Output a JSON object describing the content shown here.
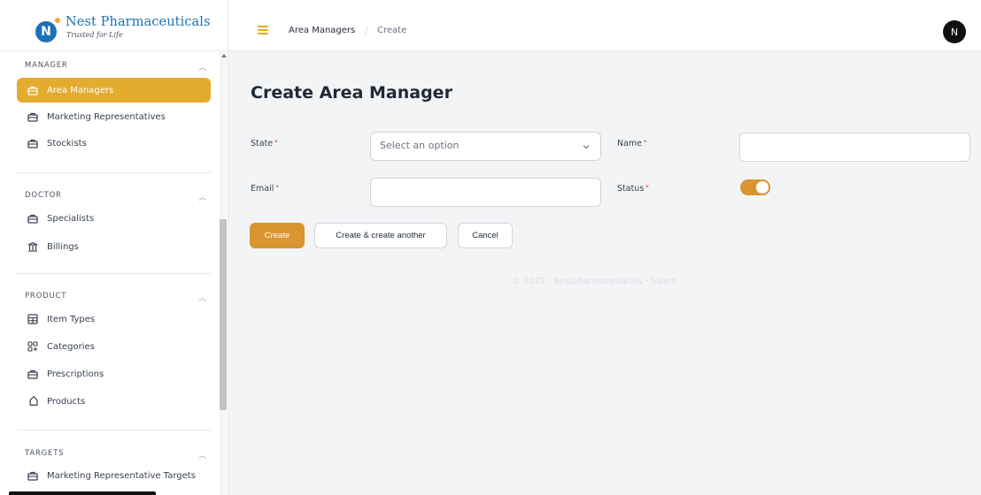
{
  "brand": {
    "name": "Nest Pharmaceuticals",
    "tagline": "Trusted for Life",
    "logo_letter": "N"
  },
  "sidebar": {
    "groups": [
      {
        "heading": "MANAGER",
        "items": [
          {
            "label": "Area Managers",
            "icon": "briefcase-icon",
            "active": true
          },
          {
            "label": "Marketing Representatives",
            "icon": "briefcase-icon"
          },
          {
            "label": "Stockists",
            "icon": "briefcase-icon"
          }
        ]
      },
      {
        "heading": "DOCTOR",
        "items": [
          {
            "label": "Specialists",
            "icon": "briefcase-icon"
          },
          {
            "label": "Billings",
            "icon": "library-icon"
          }
        ]
      },
      {
        "heading": "PRODUCT",
        "items": [
          {
            "label": "Item Types",
            "icon": "table-icon"
          },
          {
            "label": "Categories",
            "icon": "grid-plus-icon"
          },
          {
            "label": "Prescriptions",
            "icon": "briefcase-icon"
          },
          {
            "label": "Products",
            "icon": "tag-icon"
          }
        ]
      },
      {
        "heading": "TARGETS",
        "items": [
          {
            "label": "Marketing Representative Targets",
            "icon": "briefcase-icon"
          }
        ]
      }
    ]
  },
  "topbar": {
    "breadcrumb": [
      "Area Managers",
      "Create"
    ],
    "avatar_letter": "N"
  },
  "main": {
    "title": "Create Area Manager",
    "form": {
      "state_label": "State",
      "state_placeholder": "Select an option",
      "name_label": "Name",
      "name_value": "",
      "email_label": "Email",
      "email_value": "",
      "status_label": "Status",
      "status_on": true,
      "required_mark": "*"
    },
    "buttons": {
      "create": "Create",
      "create_another": "Create & create another",
      "cancel": "Cancel"
    },
    "footer": "© 2022 - Nestpharmaceuticals - Salem"
  },
  "colors": {
    "accent": "#e3ac2e",
    "primary_button": "#d99530",
    "brand_blue": "#1d6fb8"
  }
}
